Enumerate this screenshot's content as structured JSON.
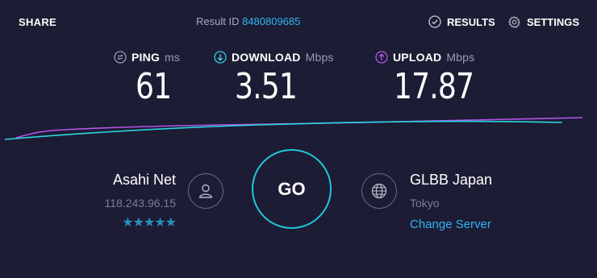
{
  "header": {
    "share_label": "SHARE",
    "result_prefix": "Result ID",
    "result_id": "8480809685",
    "results_label": "RESULTS",
    "settings_label": "SETTINGS"
  },
  "metrics": {
    "ping": {
      "label": "PING",
      "unit": "ms",
      "value": "61",
      "icon": "ping-icon"
    },
    "download": {
      "label": "DOWNLOAD",
      "unit": "Mbps",
      "value": "3.51",
      "icon": "download-arrow-icon",
      "color": "#2dd4e0"
    },
    "upload": {
      "label": "UPLOAD",
      "unit": "Mbps",
      "value": "17.87",
      "icon": "upload-arrow-icon",
      "color": "#b256e8"
    }
  },
  "isp": {
    "name": "Asahi Net",
    "ip": "118.243.96.15",
    "stars": "★★★★★",
    "icon": "user-icon"
  },
  "go_label": "GO",
  "server": {
    "name": "GLBB Japan",
    "location": "Tokyo",
    "change_label": "Change Server",
    "icon": "globe-icon"
  },
  "colors": {
    "background": "#1c1c34",
    "accent": "#2fb6f2",
    "go_ring": "#20c8dc",
    "download_line": "#2dd4e0",
    "upload_line": "#b256e8"
  }
}
